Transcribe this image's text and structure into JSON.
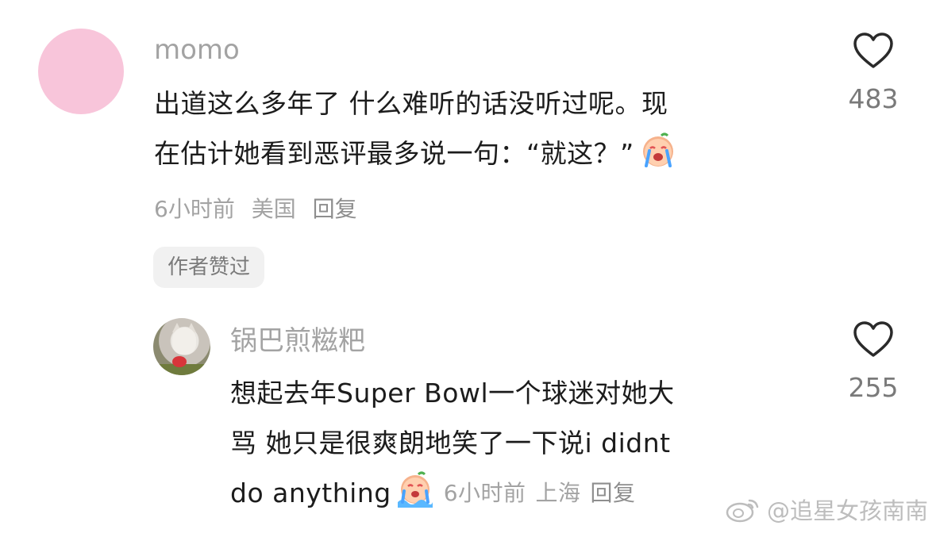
{
  "comments": [
    {
      "username": "momo",
      "text_lines": [
        "出道这么多年了 什么难听的话没听过呢。现",
        "在估计她看到恶评最多说一句：“就这？”"
      ],
      "emoji_icon": "crying-face-emoji",
      "time": "6小时前",
      "location": "美国",
      "reply_label": "回复",
      "badge": "作者赞过",
      "likes": "483"
    },
    {
      "username": "锅巴煎糍粑",
      "text_lines": [
        "想起去年Super Bowl一个球迷对她大",
        "骂 她只是很爽朗地笑了一下说i didnt",
        "do anything"
      ],
      "emoji_icon": "sobbing-face-emoji",
      "time": "6小时前",
      "location": "上海",
      "reply_label": "回复",
      "likes": "255"
    }
  ],
  "watermark": {
    "icon": "weibo-icon",
    "text": "@追星女孩南南"
  },
  "colors": {
    "text": "#1c1c1c",
    "muted": "#a3a3a3",
    "avatar_pink": "#f8c5da",
    "badge_bg": "#f1f1f1"
  }
}
